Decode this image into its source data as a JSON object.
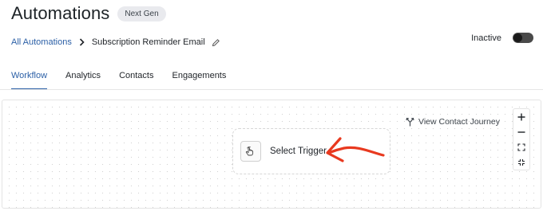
{
  "header": {
    "title": "Automations",
    "badge": "Next Gen"
  },
  "breadcrumb": {
    "parent": "All Automations",
    "current": "Subscription Reminder Email"
  },
  "status": {
    "label": "Inactive",
    "enabled": false
  },
  "tabs": [
    {
      "label": "Workflow",
      "active": true
    },
    {
      "label": "Analytics",
      "active": false
    },
    {
      "label": "Contacts",
      "active": false
    },
    {
      "label": "Engagements",
      "active": false
    }
  ],
  "canvas": {
    "journey_label": "View Contact Journey",
    "trigger_label": "Select Trigger",
    "zoom_controls": [
      "plus-icon",
      "minus-icon",
      "fit-view-icon",
      "fullscreen-icon"
    ]
  },
  "colors": {
    "accent": "#2b5fa6",
    "annotation_arrow": "#e8391f"
  }
}
